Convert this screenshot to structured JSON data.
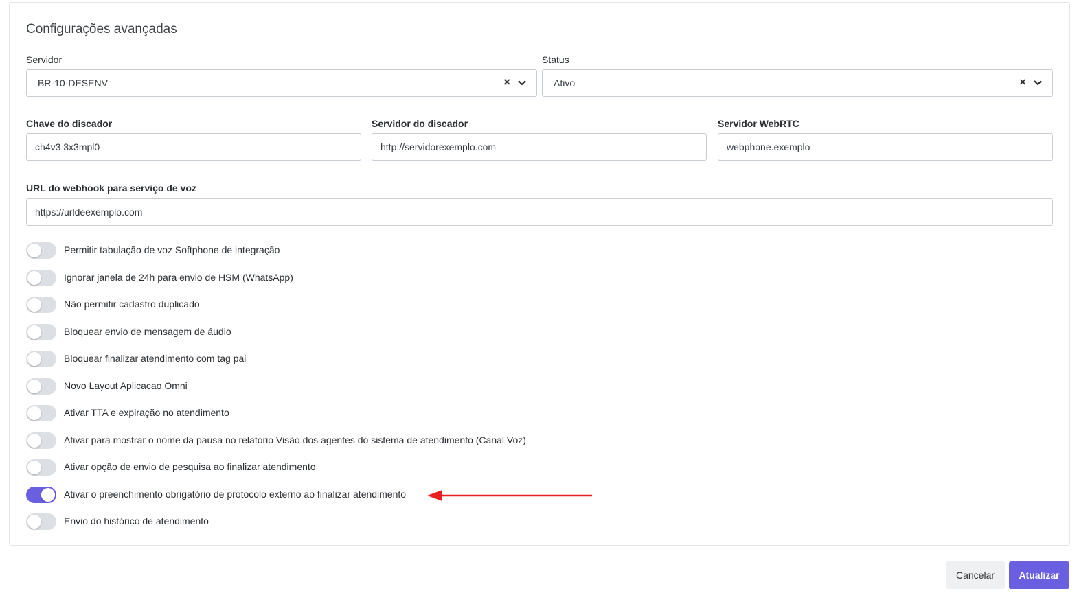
{
  "card": {
    "title": "Configurações avançadas"
  },
  "server": {
    "label": "Servidor",
    "value": "BR-10-DESENV",
    "clear_icon": "×"
  },
  "status": {
    "label": "Status",
    "value": "Ativo",
    "clear_icon": "×"
  },
  "dialer_key": {
    "label": "Chave do discador",
    "value": "ch4v3 3x3mpl0"
  },
  "dialer_server": {
    "label": "Servidor do discador",
    "value": "http://servidorexemplo.com"
  },
  "webrtc_server": {
    "label": "Servidor WebRTC",
    "value": "webphone.exemplo"
  },
  "webhook": {
    "label": "URL do webhook para serviço de voz",
    "value": "https://urldeexemplo.com"
  },
  "toggles": [
    {
      "label": "Permitir tabulação de voz Softphone de integração",
      "on": false
    },
    {
      "label": "Ignorar janela de 24h para envio de HSM (WhatsApp)",
      "on": false
    },
    {
      "label": "Não permitir cadastro duplicado",
      "on": false
    },
    {
      "label": "Bloquear envio de mensagem de áudio",
      "on": false
    },
    {
      "label": "Bloquear finalizar atendimento com tag pai",
      "on": false
    },
    {
      "label": "Novo Layout Aplicacao Omni",
      "on": false
    },
    {
      "label": "Ativar TTA e expiração no atendimento",
      "on": false
    },
    {
      "label": "Ativar para mostrar o nome da pausa no relatório Visão dos agentes do sistema de atendimento (Canal Voz)",
      "on": false
    },
    {
      "label": "Ativar opção de envio de pesquisa ao finalizar atendimento",
      "on": false
    },
    {
      "label": "Ativar o preenchimento obrigatório de protocolo externo ao finalizar atendimento",
      "on": true
    },
    {
      "label": "Envio do histórico de atendimento",
      "on": false
    }
  ],
  "buttons": {
    "cancel": "Cancelar",
    "update": "Atualizar"
  },
  "colors": {
    "accent": "#6a5fe0",
    "toggle_off": "#dcdfe3",
    "annotation_arrow": "#e8201f"
  }
}
